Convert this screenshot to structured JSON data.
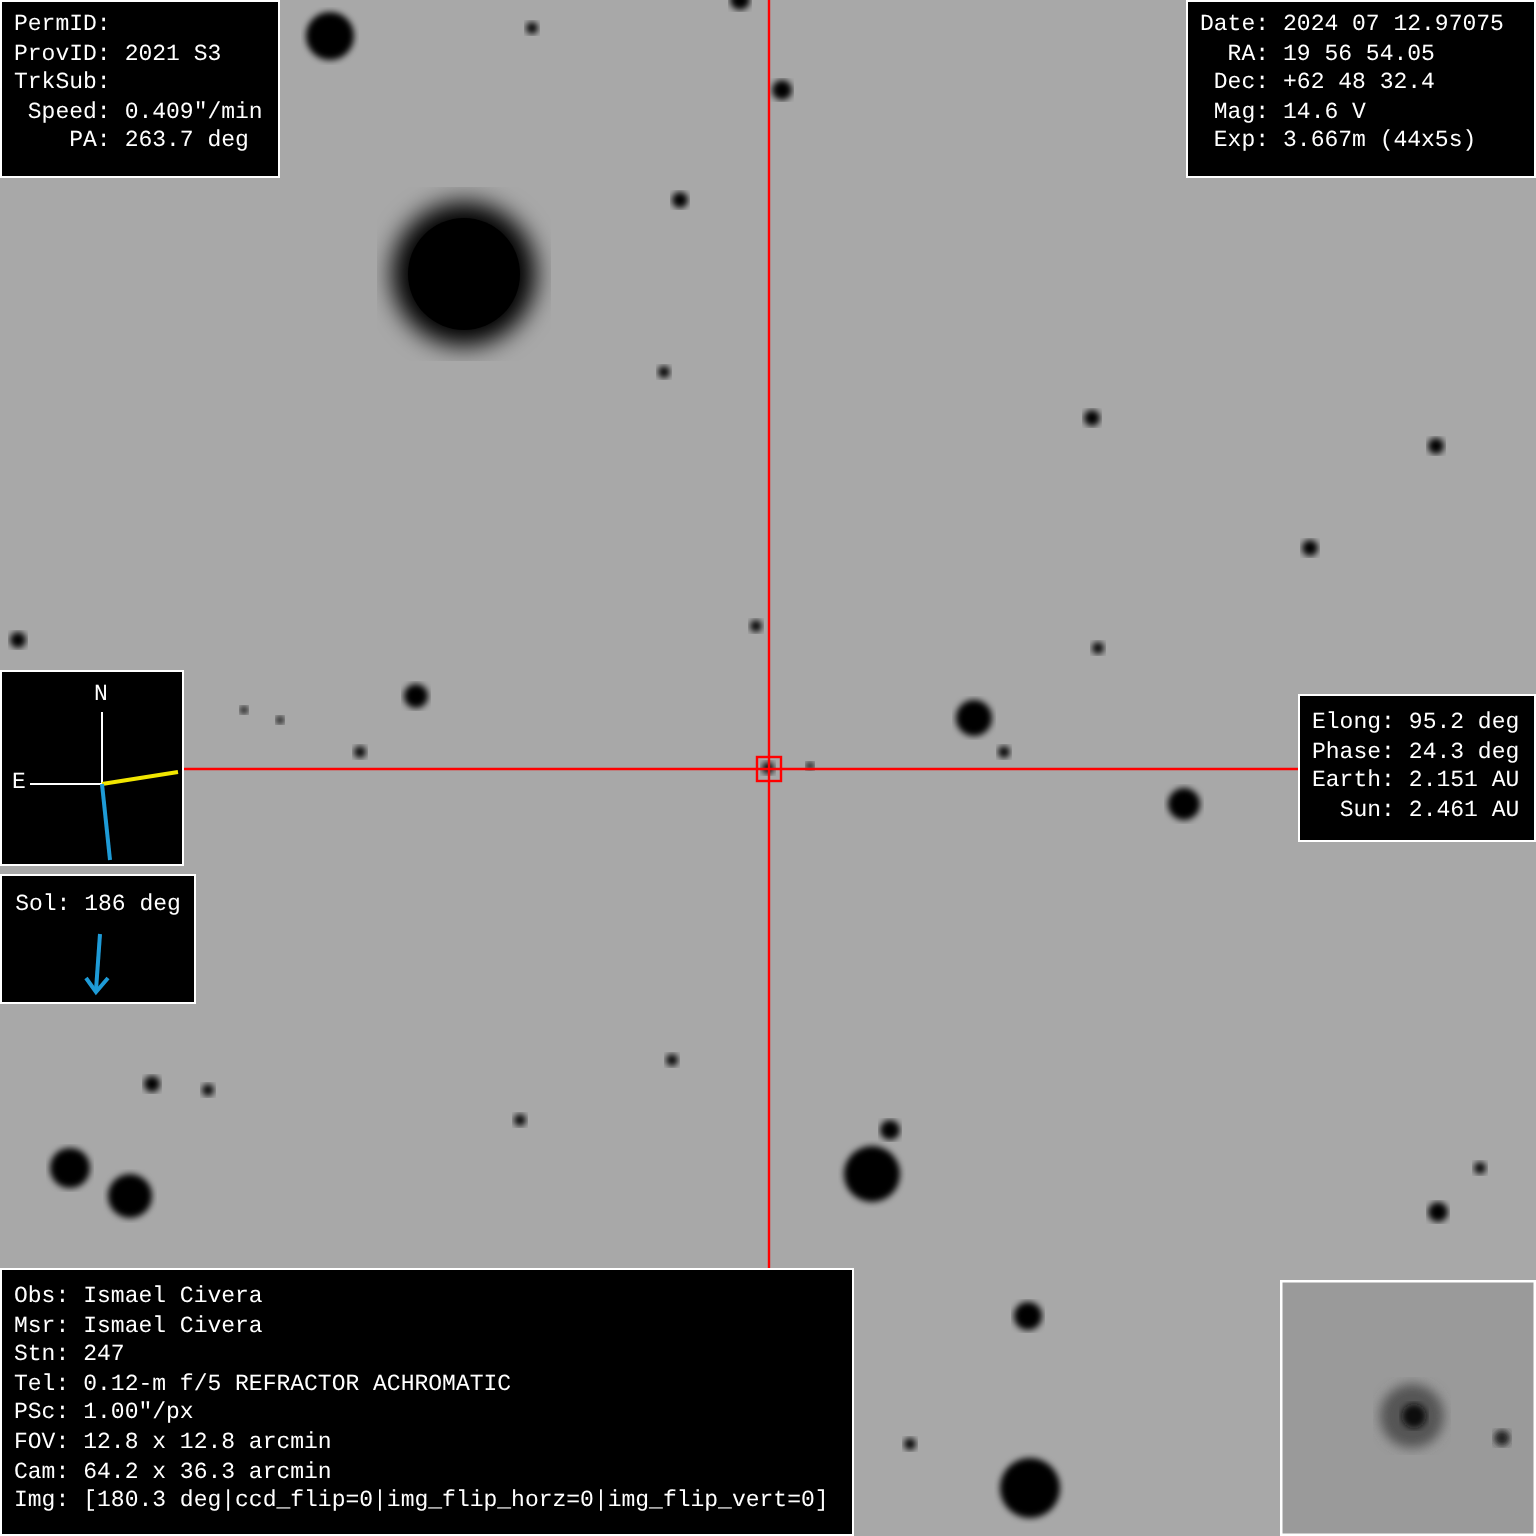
{
  "object_panel": [
    {
      "label": "PermID:"
    },
    {
      "label": "ProvID:",
      "value": "2021 S3"
    },
    {
      "label": "TrkSub:"
    },
    {
      "label": "Speed:",
      "value": "0.409\"/min"
    },
    {
      "label": "PA:",
      "value": "263.7 deg"
    }
  ],
  "observation_panel": [
    {
      "label": "Date:",
      "value": "2024 07 12.97075"
    },
    {
      "label": "RA:",
      "value": "19 56 54.05"
    },
    {
      "label": "Dec:",
      "value": "+62 48 32.4"
    },
    {
      "label": "Mag:",
      "value": "14.6 V"
    },
    {
      "label": "Exp:",
      "value": "3.667m (44x5s)"
    }
  ],
  "compass": {
    "north": "N",
    "east": "E"
  },
  "solar_panel": {
    "text": "Sol: 186 deg"
  },
  "geometry_panel": [
    {
      "label": "Elong:",
      "value": "95.2 deg"
    },
    {
      "label": "Phase:",
      "value": "24.3 deg"
    },
    {
      "label": "Earth:",
      "value": "2.151 AU"
    },
    {
      "label": "Sun:",
      "value": "2.461 AU"
    }
  ],
  "station_panel": [
    {
      "label": "Obs:",
      "value": "Ismael Civera"
    },
    {
      "label": "Msr:",
      "value": "Ismael Civera"
    },
    {
      "label": "Stn:",
      "value": "247"
    },
    {
      "label": "Tel:",
      "value": "0.12-m f/5 REFRACTOR ACHROMATIC"
    },
    {
      "label": "PSc:",
      "value": "1.00\"/px"
    },
    {
      "label": "FOV:",
      "value": "12.8 x 12.8 arcmin"
    },
    {
      "label": "Cam:",
      "value": "64.2 x 36.3 arcmin"
    },
    {
      "label": "Img:",
      "value": "[180.3 deg|ccd_flip=0|img_flip_horz=0|img_flip_vert=0]"
    }
  ]
}
